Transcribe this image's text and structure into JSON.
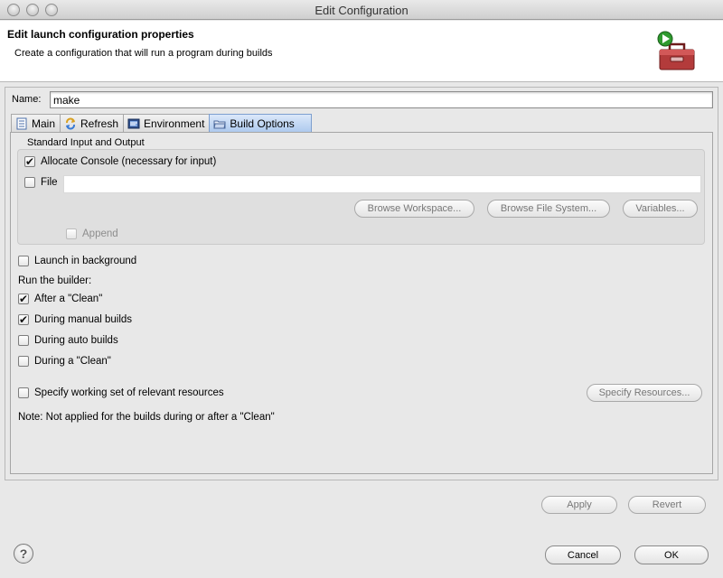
{
  "window": {
    "title": "Edit Configuration"
  },
  "header": {
    "title": "Edit launch configuration properties",
    "description": "Create a configuration that will run a program during builds",
    "icon": "toolbox-run-icon"
  },
  "name_field": {
    "label": "Name:",
    "value": "make"
  },
  "tabs": [
    {
      "label": "Main",
      "icon": "main-tab-icon",
      "active": false
    },
    {
      "label": "Refresh",
      "icon": "refresh-icon",
      "active": false
    },
    {
      "label": "Environment",
      "icon": "environment-icon",
      "active": false
    },
    {
      "label": "Build Options",
      "icon": "folder-icon",
      "active": true
    }
  ],
  "standard_io": {
    "group_title": "Standard Input and Output",
    "allocate_console": {
      "label": "Allocate Console (necessary for input)",
      "checked": true
    },
    "file": {
      "label": "File",
      "checked": false,
      "value": ""
    },
    "browse_workspace": "Browse Workspace...",
    "browse_file_system": "Browse File System...",
    "variables": "Variables...",
    "append": {
      "label": "Append",
      "checked": false
    }
  },
  "launch_in_background": {
    "label": "Launch in background",
    "checked": false
  },
  "run_builder": {
    "label": "Run the builder:",
    "after_clean": {
      "label": "After a \"Clean\"",
      "checked": true
    },
    "manual_builds": {
      "label": "During manual builds",
      "checked": true
    },
    "auto_builds": {
      "label": "During auto builds",
      "checked": false
    },
    "during_clean": {
      "label": "During a \"Clean\"",
      "checked": false
    }
  },
  "working_set": {
    "label": "Specify working set of relevant resources",
    "checked": false,
    "button": "Specify Resources..."
  },
  "note": "Note: Not applied for the builds during or after a \"Clean\"",
  "footer": {
    "apply": "Apply",
    "revert": "Revert",
    "cancel": "Cancel",
    "ok": "OK",
    "help": "?"
  }
}
